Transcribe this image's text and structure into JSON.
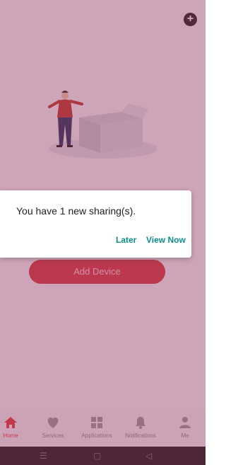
{
  "main": {
    "add_button_icon": "plus-circle-icon",
    "add_device_label": "Add Device"
  },
  "tabbar": {
    "items": [
      {
        "label": "Home",
        "icon": "home-icon",
        "active": true
      },
      {
        "label": "Services",
        "icon": "heart-icon",
        "active": false
      },
      {
        "label": "Applications",
        "icon": "grid-icon",
        "active": false
      },
      {
        "label": "Notifications",
        "icon": "bell-icon",
        "active": false
      },
      {
        "label": "Me",
        "icon": "person-icon",
        "active": false
      }
    ]
  },
  "dialog": {
    "message": "You have 1 new sharing(s).",
    "later_label": "Later",
    "view_now_label": "View Now"
  },
  "system_nav": {
    "menu": "☰",
    "home": "▢",
    "back": "◁"
  },
  "colors": {
    "accent_red": "#d83a42",
    "dialog_button_teal": "#0e8c8c",
    "scrim": "#96375f"
  }
}
